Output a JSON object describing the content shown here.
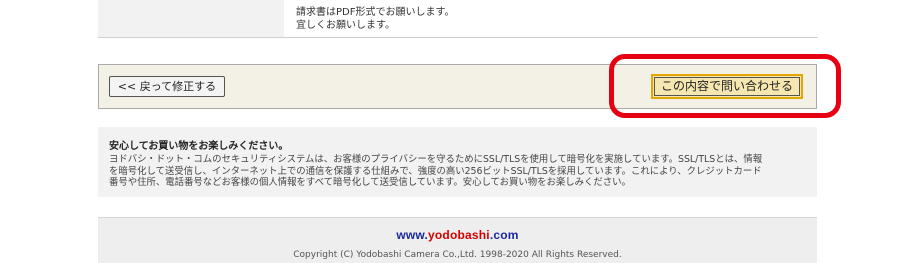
{
  "remark": {
    "line1": "請求書はPDF形式でお願いします。",
    "line2": "宜しくお願いします。"
  },
  "actions": {
    "back_label": "<< 戻って修正する",
    "submit_label": "この内容で問い合わせる",
    "highlight_color": "#e60012"
  },
  "security": {
    "title": "安心してお買い物をお楽しみください。",
    "line1": "ヨドバシ・ドット・コムのセキュリティシステムは、お客様のプライバシーを守るためにSSL/TLSを使用して暗号化を実施しています。SSL/TLSとは、情報",
    "line2": "を暗号化して送受信し、インターネット上での通信を保護する仕組みで、強度の高い256ビットSSL/TLSを採用しています。これにより、クレジットカード",
    "line3": "番号や住所、電話番号などお客様の個人情報をすべて暗号化して送受信しています。安心してお買い物をお楽しみください。"
  },
  "footer": {
    "logo_prefix": "www.",
    "logo_name": "yodobashi",
    "logo_suffix": ".com",
    "copyright": "Copyright (C) Yodobashi Camera Co.,Ltd. 1998-2020 All Rights Reserved."
  }
}
